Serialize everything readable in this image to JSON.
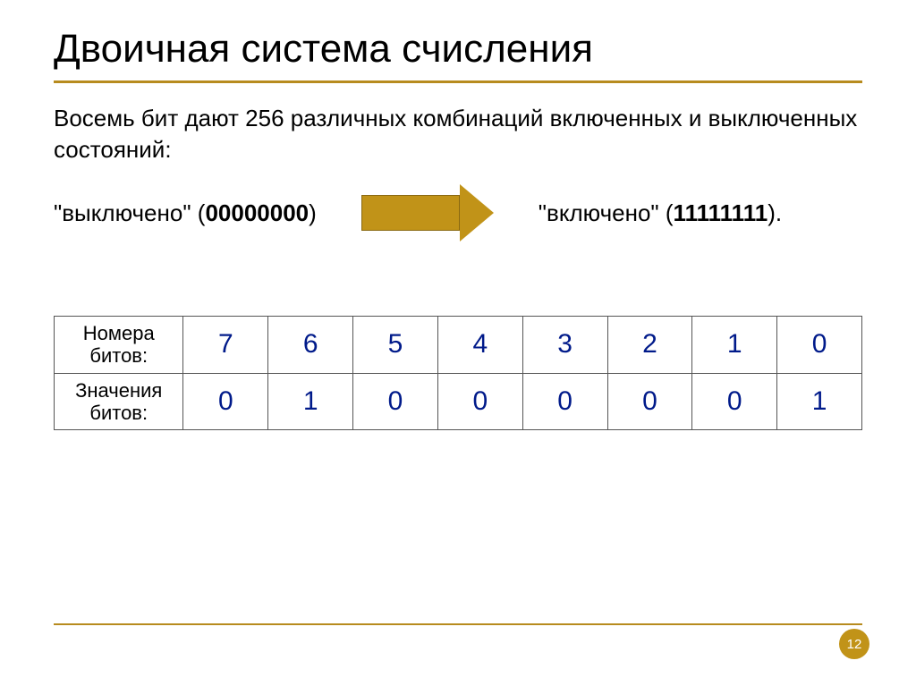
{
  "title": "Двоичная система счисления",
  "paragraph": "Восемь бит дают 256 различных комбинаций включенных и выключенных состояний:",
  "state_off": {
    "prefix": "\"выключено\" (",
    "bits": "00000000",
    "suffix": ")"
  },
  "state_on": {
    "prefix": "\"включено\" (",
    "bits": "11111111",
    "suffix": ")."
  },
  "table": {
    "row1_label": "Номера битов:",
    "row1_values": [
      "7",
      "6",
      "5",
      "4",
      "3",
      "2",
      "1",
      "0"
    ],
    "row2_label": "Значения битов:",
    "row2_values": [
      "0",
      "1",
      "0",
      "0",
      "0",
      "0",
      "0",
      "1"
    ]
  },
  "page_number": "12"
}
